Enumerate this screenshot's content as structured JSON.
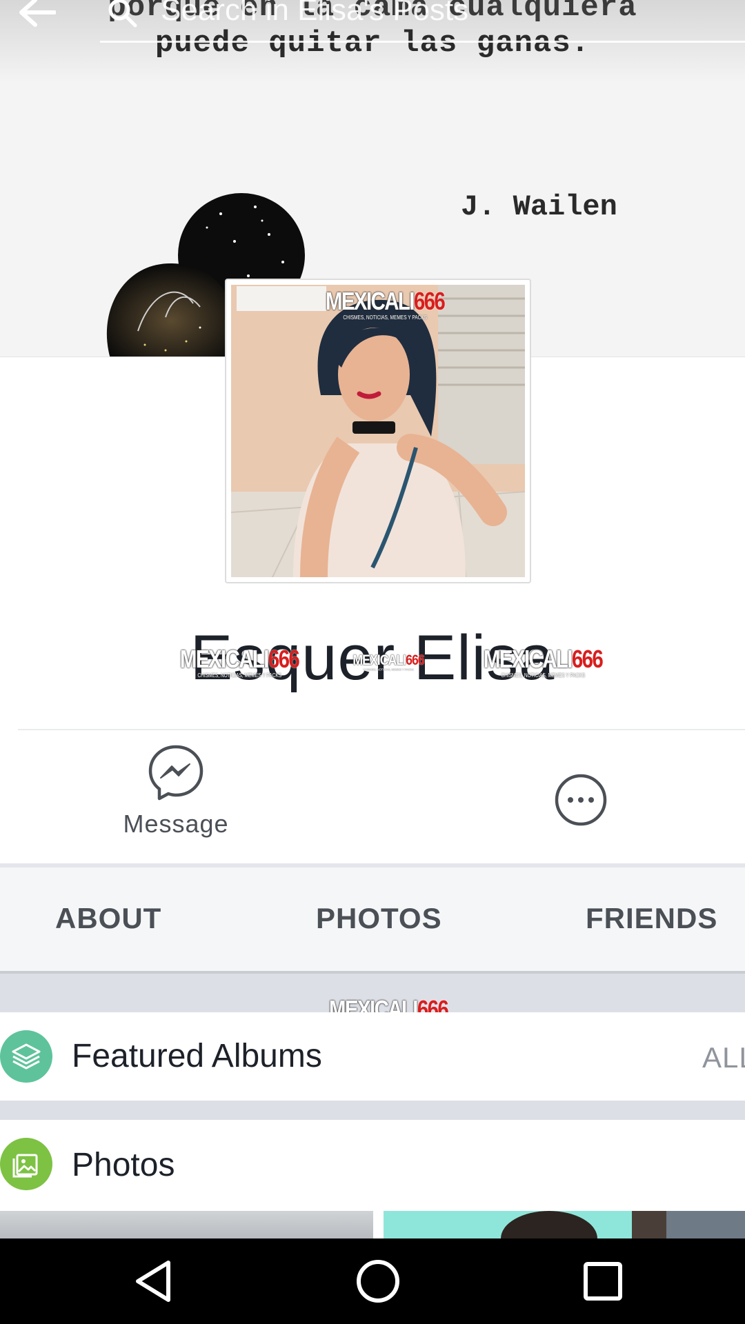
{
  "search": {
    "placeholder": "Search in Elisa's Posts"
  },
  "cover": {
    "quote_line_1": "porque en la cama cualquiera",
    "quote_line_2": "puede quitar las ganas.",
    "author": "J. Wailen"
  },
  "watermark": {
    "brand_white": "MEXICALI",
    "brand_red": "666",
    "tagline": "CHISMES, NOTICIAS, MEMES Y PACKS"
  },
  "profile": {
    "name": "Esquer Elisa"
  },
  "actions": {
    "message_label": "Message"
  },
  "tabs": [
    {
      "label": "ABOUT"
    },
    {
      "label": "PHOTOS"
    },
    {
      "label": "FRIENDS"
    }
  ],
  "featured_albums": {
    "title": "Featured Albums",
    "all_label": "ALL"
  },
  "photos": {
    "title": "Photos"
  },
  "colors": {
    "featured_icon": "#5ec39b",
    "photos_icon": "#7dc243",
    "watermark_red": "#d81e1e",
    "tab_text": "#4b4f56"
  },
  "icons": [
    "back-arrow-icon",
    "search-icon",
    "messenger-icon",
    "more-options-icon",
    "albums-stack-icon",
    "photo-gallery-icon",
    "nav-back-icon",
    "nav-home-icon",
    "nav-recents-icon"
  ]
}
